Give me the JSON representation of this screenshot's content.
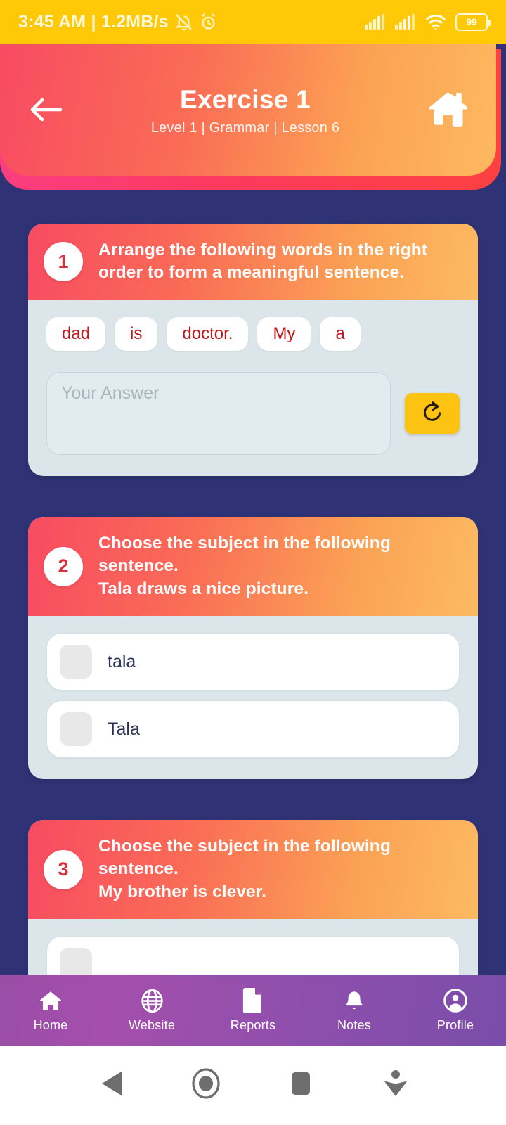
{
  "status_bar": {
    "time_and_speed": "3:45 AM | 1.2MB/s",
    "icons": [
      "bell-muted-icon",
      "alarm-icon",
      "signal-1-icon",
      "signal-2-icon",
      "wifi-icon"
    ],
    "battery_level": "99",
    "background_color": "#FFC907"
  },
  "header": {
    "back_label": "back-arrow",
    "title": "Exercise 1",
    "subtitle": "Level 1 | Grammar | Lesson 6",
    "home_label": "home-icon",
    "gradient_start": "#F84B62",
    "gradient_end": "#FDB95F",
    "behind_gradient_start": "#FB3E86",
    "behind_gradient_end": "#FF4040"
  },
  "page_background": "#2F3375",
  "questions": [
    {
      "number": "1",
      "prompt": "Arrange the following words in the right order to form a meaningful sentence.",
      "sentence": "",
      "type": "arrange",
      "words": [
        "dad",
        "is",
        "doctor.",
        "My",
        "a"
      ],
      "answer_value": "",
      "answer_placeholder": "Your Answer",
      "reset_label": "reset-icon"
    },
    {
      "number": "2",
      "prompt": "Choose the subject in the following sentence.",
      "sentence": "Tala draws a nice picture.",
      "type": "choice",
      "options": [
        {
          "label": "tala",
          "checked": false
        },
        {
          "label": "Tala",
          "checked": false
        }
      ]
    },
    {
      "number": "3",
      "prompt": "Choose the subject in the following sentence.",
      "sentence": "My brother is clever.",
      "type": "choice",
      "options": [
        {
          "label": "",
          "checked": false
        }
      ]
    }
  ],
  "bottom_nav": {
    "items": [
      {
        "label": "Home",
        "icon": "home-icon"
      },
      {
        "label": "Website",
        "icon": "globe-icon"
      },
      {
        "label": "Reports",
        "icon": "document-icon"
      },
      {
        "label": "Notes",
        "icon": "bell-icon"
      },
      {
        "label": "Profile",
        "icon": "person-circle-icon"
      }
    ],
    "gradient_start": "#9A4EA6",
    "gradient_end": "#7A4DAA"
  },
  "system_bar": {
    "buttons": [
      "back-triangle-icon",
      "home-circle-icon",
      "recents-square-icon",
      "collapse-arrow-icon"
    ]
  }
}
